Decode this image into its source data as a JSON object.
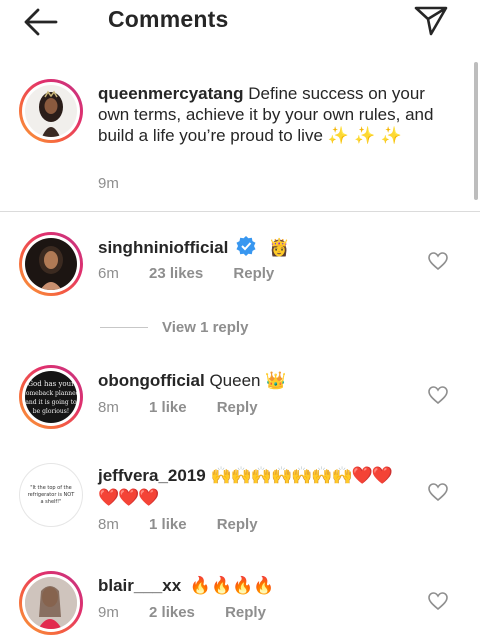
{
  "header": {
    "title": "Comments"
  },
  "caption": {
    "username": "queenmercyatang",
    "text": "Define success on your own terms, achieve it by your own rules, and build a life you’re proud to live",
    "emoji": "✨ ✨ ✨",
    "time": "9m"
  },
  "comments": [
    {
      "username": "singhniniofficial",
      "verified": true,
      "text": "",
      "emoji": "👸",
      "time": "6m",
      "likes": "23 likes",
      "reply": "Reply"
    },
    {
      "username": "obongofficial",
      "text": "Queen",
      "emoji": "👑",
      "time": "8m",
      "likes": "1 like",
      "reply": "Reply"
    },
    {
      "username": "jeffvera_2019",
      "text": "",
      "emoji": "🙌🙌🙌🙌🙌🙌🙌❤️❤️❤️❤️❤️",
      "time": "8m",
      "likes": "1 like",
      "reply": "Reply"
    },
    {
      "username": "blair___xx",
      "text": "",
      "emoji": "🔥🔥🔥🔥",
      "time": "9m",
      "likes": "2 likes",
      "reply": "Reply"
    }
  ],
  "view_replies": "View 1 reply",
  "avatars": {
    "obong_text": "God has your comeback planned and it is going to be glorious!",
    "jeff_text": "\"It the top of the refrigerator is NOT a shelf!\" 😂😂"
  }
}
